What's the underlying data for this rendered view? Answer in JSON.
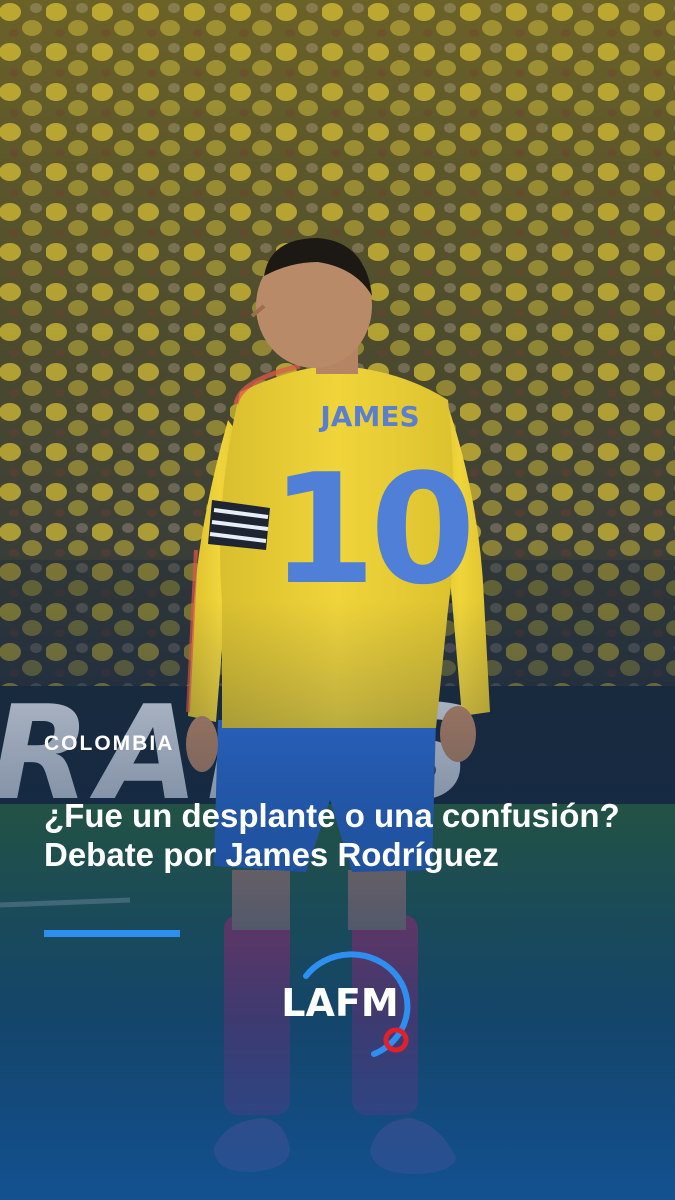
{
  "post": {
    "category": "COLOMBIA",
    "headline": "¿Fue un desplante o una confusión? Debate por James Rodríguez"
  },
  "photo": {
    "jersey_name": "JAMES",
    "jersey_number": "10",
    "banner_text": "RADIS"
  },
  "brand": {
    "logo_text": "LAFM",
    "accent_color": "#2f8ff0",
    "logo_ring_color": "#2f8ff0",
    "logo_dot_color": "#e0202a"
  },
  "colors": {
    "jersey_yellow": "#f0d43a",
    "shorts_blue": "#2f6fd6",
    "socks_red": "#c9355a"
  }
}
